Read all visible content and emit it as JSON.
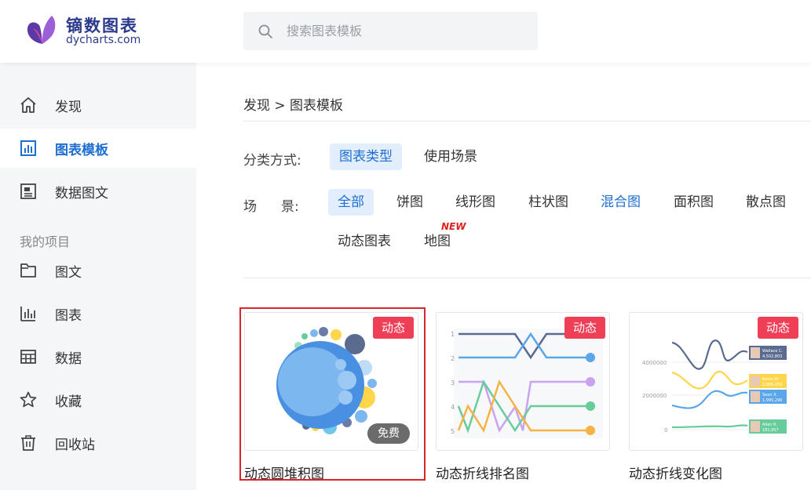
{
  "header": {
    "logo_cn": "镝数图表",
    "logo_en": "dycharts.com",
    "search": {
      "placeholder": "搜索图表模板",
      "value": ""
    }
  },
  "sidebar": {
    "items": [
      {
        "label": "发现",
        "icon": "home-icon"
      },
      {
        "label": "图表模板",
        "icon": "chart-template-icon",
        "active": true
      },
      {
        "label": "数据图文",
        "icon": "article-icon"
      }
    ],
    "group_title": "我的项目",
    "project_items": [
      {
        "label": "图文",
        "icon": "folder-icon"
      },
      {
        "label": "图表",
        "icon": "bar-chart-icon"
      },
      {
        "label": "数据",
        "icon": "table-icon"
      },
      {
        "label": "收藏",
        "icon": "star-icon"
      },
      {
        "label": "回收站",
        "icon": "trash-icon"
      }
    ]
  },
  "main": {
    "breadcrumb": "发现 > 图表模板",
    "classify": {
      "label": "分类方式:",
      "options": [
        "图表类型",
        "使用场景"
      ],
      "selected": "图表类型"
    },
    "scene": {
      "label_a": "场",
      "label_b": "景:",
      "options": [
        "全部",
        "饼图",
        "线形图",
        "柱状图",
        "混合图",
        "面积图",
        "散点图",
        "动态图表",
        "地图"
      ],
      "selected": "全部",
      "new_badge": "NEW"
    },
    "cards": [
      {
        "title": "动态圆堆积图",
        "tag": "动态",
        "free": "免费"
      },
      {
        "title": "动态折线排名图",
        "tag": "动态"
      },
      {
        "title": "动态折线变化图",
        "tag": "动态"
      }
    ],
    "thumb2": {
      "ranks": [
        "1",
        "2",
        "3",
        "4",
        "5"
      ]
    },
    "thumb3": {
      "y_ticks": [
        "4000000",
        "2000000",
        "0"
      ],
      "labels": [
        {
          "name": "Wallace C.",
          "value": "4,502,803"
        },
        {
          "name": "Kevin W.",
          "value": "2,866,459"
        },
        {
          "name": "Sean X.",
          "value": "1,995,290"
        },
        {
          "name": "Allen R.",
          "value": "181,957"
        }
      ]
    }
  },
  "colors": {
    "accent": "#1f6fd1",
    "tag_dynamic": "#ef3f57",
    "highlight_border": "#d9262c"
  }
}
